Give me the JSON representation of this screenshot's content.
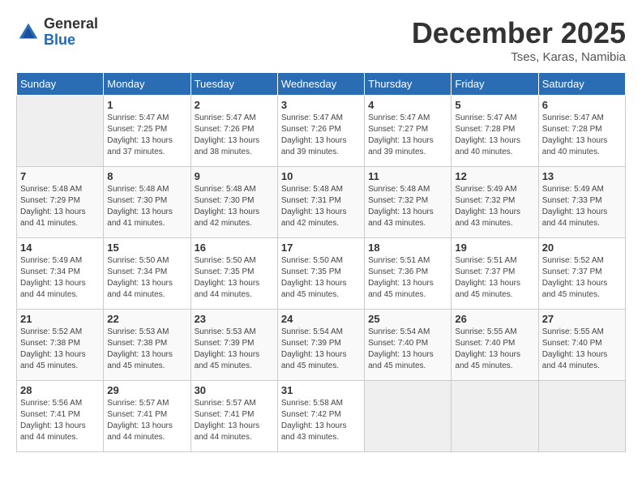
{
  "header": {
    "logo_general": "General",
    "logo_blue": "Blue",
    "month_title": "December 2025",
    "location": "Tses, Karas, Namibia"
  },
  "days_of_week": [
    "Sunday",
    "Monday",
    "Tuesday",
    "Wednesday",
    "Thursday",
    "Friday",
    "Saturday"
  ],
  "weeks": [
    [
      {
        "day": "",
        "empty": true
      },
      {
        "day": "1",
        "sunrise": "Sunrise: 5:47 AM",
        "sunset": "Sunset: 7:25 PM",
        "daylight": "Daylight: 13 hours and 37 minutes."
      },
      {
        "day": "2",
        "sunrise": "Sunrise: 5:47 AM",
        "sunset": "Sunset: 7:26 PM",
        "daylight": "Daylight: 13 hours and 38 minutes."
      },
      {
        "day": "3",
        "sunrise": "Sunrise: 5:47 AM",
        "sunset": "Sunset: 7:26 PM",
        "daylight": "Daylight: 13 hours and 39 minutes."
      },
      {
        "day": "4",
        "sunrise": "Sunrise: 5:47 AM",
        "sunset": "Sunset: 7:27 PM",
        "daylight": "Daylight: 13 hours and 39 minutes."
      },
      {
        "day": "5",
        "sunrise": "Sunrise: 5:47 AM",
        "sunset": "Sunset: 7:28 PM",
        "daylight": "Daylight: 13 hours and 40 minutes."
      },
      {
        "day": "6",
        "sunrise": "Sunrise: 5:47 AM",
        "sunset": "Sunset: 7:28 PM",
        "daylight": "Daylight: 13 hours and 40 minutes."
      }
    ],
    [
      {
        "day": "7",
        "sunrise": "Sunrise: 5:48 AM",
        "sunset": "Sunset: 7:29 PM",
        "daylight": "Daylight: 13 hours and 41 minutes."
      },
      {
        "day": "8",
        "sunrise": "Sunrise: 5:48 AM",
        "sunset": "Sunset: 7:30 PM",
        "daylight": "Daylight: 13 hours and 41 minutes."
      },
      {
        "day": "9",
        "sunrise": "Sunrise: 5:48 AM",
        "sunset": "Sunset: 7:30 PM",
        "daylight": "Daylight: 13 hours and 42 minutes."
      },
      {
        "day": "10",
        "sunrise": "Sunrise: 5:48 AM",
        "sunset": "Sunset: 7:31 PM",
        "daylight": "Daylight: 13 hours and 42 minutes."
      },
      {
        "day": "11",
        "sunrise": "Sunrise: 5:48 AM",
        "sunset": "Sunset: 7:32 PM",
        "daylight": "Daylight: 13 hours and 43 minutes."
      },
      {
        "day": "12",
        "sunrise": "Sunrise: 5:49 AM",
        "sunset": "Sunset: 7:32 PM",
        "daylight": "Daylight: 13 hours and 43 minutes."
      },
      {
        "day": "13",
        "sunrise": "Sunrise: 5:49 AM",
        "sunset": "Sunset: 7:33 PM",
        "daylight": "Daylight: 13 hours and 44 minutes."
      }
    ],
    [
      {
        "day": "14",
        "sunrise": "Sunrise: 5:49 AM",
        "sunset": "Sunset: 7:34 PM",
        "daylight": "Daylight: 13 hours and 44 minutes."
      },
      {
        "day": "15",
        "sunrise": "Sunrise: 5:50 AM",
        "sunset": "Sunset: 7:34 PM",
        "daylight": "Daylight: 13 hours and 44 minutes."
      },
      {
        "day": "16",
        "sunrise": "Sunrise: 5:50 AM",
        "sunset": "Sunset: 7:35 PM",
        "daylight": "Daylight: 13 hours and 44 minutes."
      },
      {
        "day": "17",
        "sunrise": "Sunrise: 5:50 AM",
        "sunset": "Sunset: 7:35 PM",
        "daylight": "Daylight: 13 hours and 45 minutes."
      },
      {
        "day": "18",
        "sunrise": "Sunrise: 5:51 AM",
        "sunset": "Sunset: 7:36 PM",
        "daylight": "Daylight: 13 hours and 45 minutes."
      },
      {
        "day": "19",
        "sunrise": "Sunrise: 5:51 AM",
        "sunset": "Sunset: 7:37 PM",
        "daylight": "Daylight: 13 hours and 45 minutes."
      },
      {
        "day": "20",
        "sunrise": "Sunrise: 5:52 AM",
        "sunset": "Sunset: 7:37 PM",
        "daylight": "Daylight: 13 hours and 45 minutes."
      }
    ],
    [
      {
        "day": "21",
        "sunrise": "Sunrise: 5:52 AM",
        "sunset": "Sunset: 7:38 PM",
        "daylight": "Daylight: 13 hours and 45 minutes."
      },
      {
        "day": "22",
        "sunrise": "Sunrise: 5:53 AM",
        "sunset": "Sunset: 7:38 PM",
        "daylight": "Daylight: 13 hours and 45 minutes."
      },
      {
        "day": "23",
        "sunrise": "Sunrise: 5:53 AM",
        "sunset": "Sunset: 7:39 PM",
        "daylight": "Daylight: 13 hours and 45 minutes."
      },
      {
        "day": "24",
        "sunrise": "Sunrise: 5:54 AM",
        "sunset": "Sunset: 7:39 PM",
        "daylight": "Daylight: 13 hours and 45 minutes."
      },
      {
        "day": "25",
        "sunrise": "Sunrise: 5:54 AM",
        "sunset": "Sunset: 7:40 PM",
        "daylight": "Daylight: 13 hours and 45 minutes."
      },
      {
        "day": "26",
        "sunrise": "Sunrise: 5:55 AM",
        "sunset": "Sunset: 7:40 PM",
        "daylight": "Daylight: 13 hours and 45 minutes."
      },
      {
        "day": "27",
        "sunrise": "Sunrise: 5:55 AM",
        "sunset": "Sunset: 7:40 PM",
        "daylight": "Daylight: 13 hours and 44 minutes."
      }
    ],
    [
      {
        "day": "28",
        "sunrise": "Sunrise: 5:56 AM",
        "sunset": "Sunset: 7:41 PM",
        "daylight": "Daylight: 13 hours and 44 minutes."
      },
      {
        "day": "29",
        "sunrise": "Sunrise: 5:57 AM",
        "sunset": "Sunset: 7:41 PM",
        "daylight": "Daylight: 13 hours and 44 minutes."
      },
      {
        "day": "30",
        "sunrise": "Sunrise: 5:57 AM",
        "sunset": "Sunset: 7:41 PM",
        "daylight": "Daylight: 13 hours and 44 minutes."
      },
      {
        "day": "31",
        "sunrise": "Sunrise: 5:58 AM",
        "sunset": "Sunset: 7:42 PM",
        "daylight": "Daylight: 13 hours and 43 minutes."
      },
      {
        "day": "",
        "empty": true
      },
      {
        "day": "",
        "empty": true
      },
      {
        "day": "",
        "empty": true
      }
    ]
  ]
}
